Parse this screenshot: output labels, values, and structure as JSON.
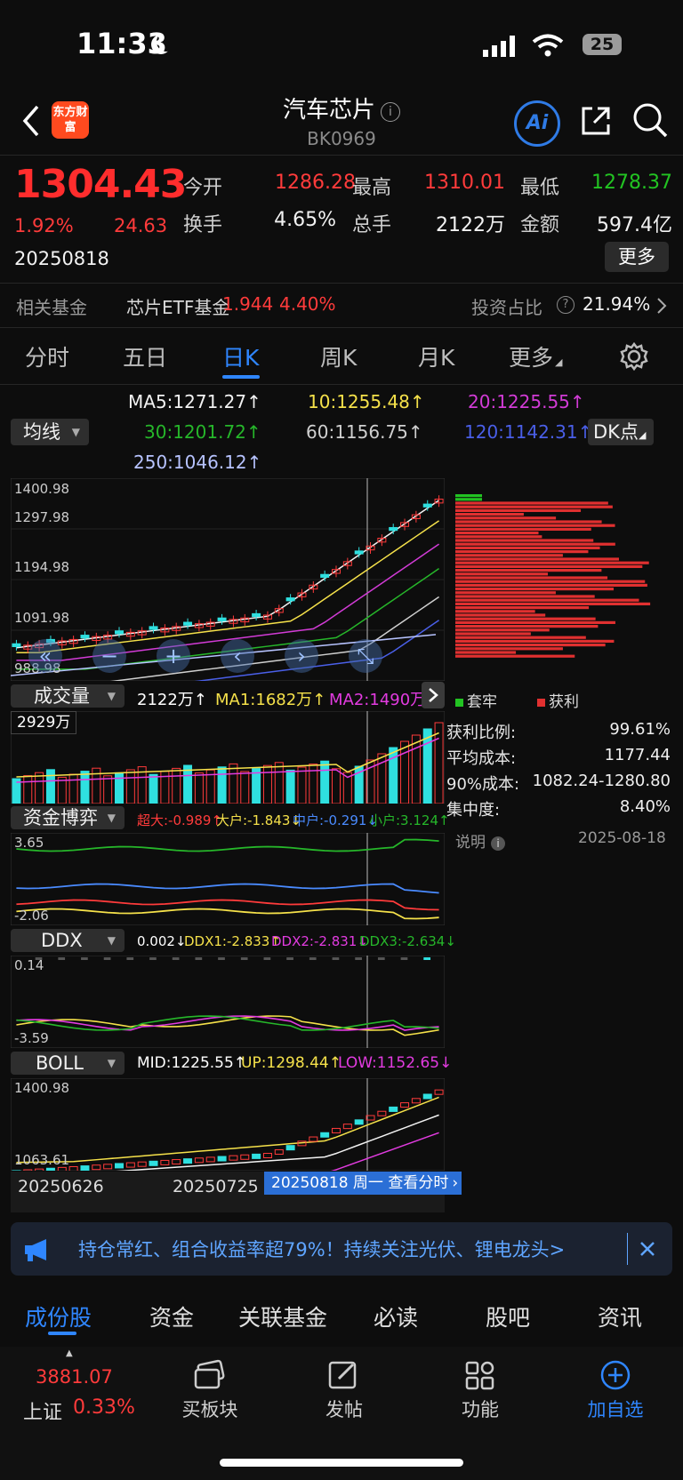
{
  "status_bar": {
    "time": "11:33",
    "battery": "25"
  },
  "header": {
    "title": "汽车芯片",
    "code": "BK0969",
    "logo_text": "东方财富",
    "ai_label": "Ai"
  },
  "quote": {
    "price": "1304.43",
    "change_pct": "1.92%",
    "change": "24.63",
    "date": "20250818",
    "open_label": "今开",
    "open": "1286.28",
    "high_label": "最高",
    "high": "1310.01",
    "low_label": "最低",
    "low": "1278.37",
    "turnover_label": "换手",
    "turnover": "4.65%",
    "volume_label": "总手",
    "volume": "2122万",
    "amount_label": "金额",
    "amount": "597.4亿",
    "more_label": "更多"
  },
  "fund_bar": {
    "label": "相关基金",
    "fund_name": "芯片ETF基金",
    "fund_price": "1.944",
    "fund_pct": "4.40%",
    "ratio_label": "投资占比",
    "ratio": "21.94%"
  },
  "tabs": {
    "items": [
      "分时",
      "五日",
      "日K",
      "周K",
      "月K",
      "更多"
    ],
    "active": "日K"
  },
  "ma_panel": {
    "dropdown": "均线",
    "dk_label": "DK点",
    "ma5": "MA5:1271.27↑",
    "ma10": "10:1255.48↑",
    "ma20": "20:1225.55↑",
    "ma30": "30:1201.72↑",
    "ma60": "60:1156.75↑",
    "ma120": "120:1142.31↑",
    "ma250": "250:1046.12↑"
  },
  "kline": {
    "y_labels": [
      "1400.98",
      "1297.98",
      "1194.98",
      "1091.98",
      "988.98"
    ]
  },
  "volume_panel": {
    "dropdown": "成交量",
    "vol": "2122万↑",
    "ma1": "MA1:1682万↑",
    "ma2": "MA2:1490万↑",
    "y_label": "2929万"
  },
  "capital_panel": {
    "dropdown": "资金博弈",
    "super": "超大:-0.989↑",
    "large": "大户:-1.843↓",
    "mid": "中户:-0.291↓",
    "small": "小户:3.124↑",
    "y_top": "3.65",
    "y_bottom": "-2.06"
  },
  "ddx_panel": {
    "dropdown": "DDX",
    "ddx": "0.002↓",
    "ddx1": "DDX1:-2.833↑",
    "ddx2": "DDX2:-2.831↓",
    "ddx3": "DDX3:-2.634↓",
    "y_top": "0.14",
    "y_bottom": "-3.59"
  },
  "boll_panel": {
    "dropdown": "BOLL",
    "mid": "MID:1225.55↑",
    "up": "UP:1298.44↑",
    "low": "LOW:1152.65↓",
    "y_top": "1400.98",
    "y_bottom": "1063.61"
  },
  "x_axis": {
    "start": "20250626",
    "mid": "20250725",
    "cursor_label": "20250818 周一 查看分时"
  },
  "chip_dist": {
    "legend_trap": "套牢",
    "legend_profit": "获利",
    "rows": [
      {
        "label": "获利比例:",
        "value": "99.61%"
      },
      {
        "label": "平均成本:",
        "value": "1177.44"
      },
      {
        "label": "90%成本:",
        "value": "1082.24-1280.80"
      },
      {
        "label": "集中度:",
        "value": "8.40%"
      }
    ],
    "note_label": "说明",
    "note_date": "2025-08-18"
  },
  "banner": {
    "text": "持仓常红、组合收益率超79%！持续关注光伏、锂电龙头>"
  },
  "bottom_tabs": {
    "items": [
      "成份股",
      "资金",
      "关联基金",
      "必读",
      "股吧",
      "资讯"
    ],
    "active": "成份股"
  },
  "bottom_nav": {
    "index_value": "3881.07",
    "index_name": "上证",
    "index_pct": "0.33%",
    "items": [
      "买板块",
      "发帖",
      "功能",
      "加自选"
    ]
  },
  "colors": {
    "up": "#ff3b3b",
    "down": "#22c322",
    "accent": "#2f86ff",
    "bg": "#0d0d0d"
  }
}
